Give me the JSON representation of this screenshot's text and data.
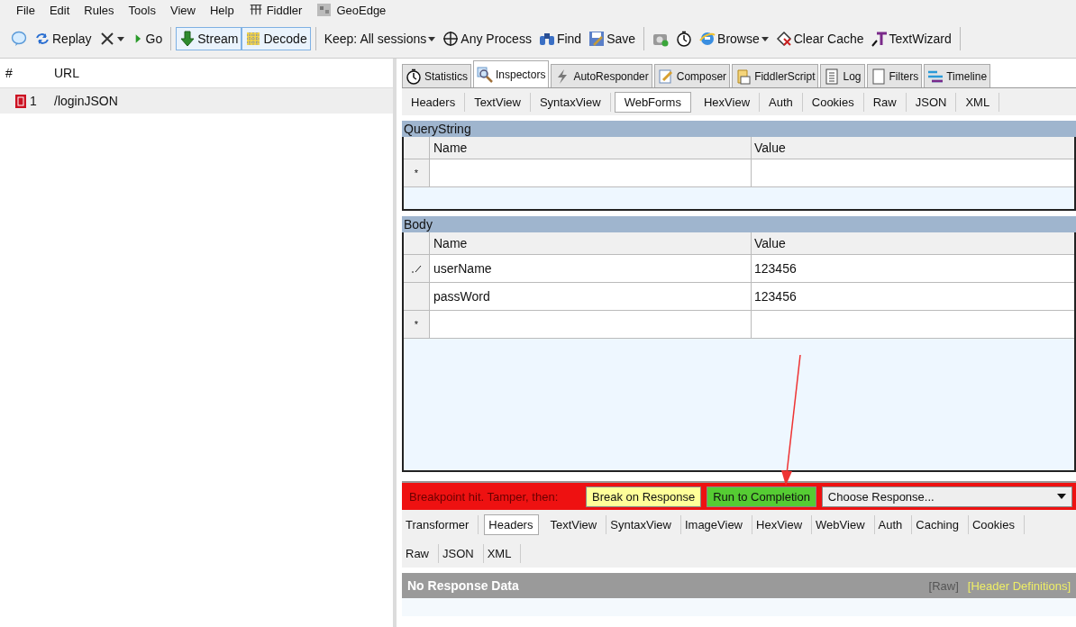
{
  "menu": [
    {
      "label": "File",
      "kind": "text"
    },
    {
      "label": "Edit",
      "kind": "text"
    },
    {
      "label": "Rules",
      "kind": "text"
    },
    {
      "label": "Tools",
      "kind": "text"
    },
    {
      "label": "View",
      "kind": "text"
    },
    {
      "label": "Help",
      "kind": "text"
    },
    {
      "label": "Fiddler",
      "kind": "grid"
    },
    {
      "label": "GeoEdge",
      "kind": "tile"
    }
  ],
  "toolbar": [
    {
      "kind": "bubble",
      "dropdown": false,
      "selected": false
    },
    {
      "label": "Replay",
      "kind": "replay",
      "dropdown": false,
      "selected": false
    },
    {
      "kind": "x",
      "dropdown": true,
      "selected": false
    },
    {
      "label": "Go",
      "kind": "play",
      "dropdown": false,
      "selected": false
    },
    {
      "kind": "separator"
    },
    {
      "label": "Stream",
      "kind": "down",
      "dropdown": false,
      "selected": true
    },
    {
      "label": "Decode",
      "kind": "decode",
      "dropdown": false,
      "selected": true
    },
    {
      "kind": "separator"
    },
    {
      "label": "Keep: All sessions",
      "kind": "text",
      "dropdown": true,
      "selected": false
    },
    {
      "label": "Any Process",
      "kind": "target",
      "dropdown": false,
      "selected": false
    },
    {
      "label": "Find",
      "kind": "binoculars",
      "dropdown": false,
      "selected": false
    },
    {
      "label": "Save",
      "kind": "save",
      "dropdown": false,
      "selected": false
    },
    {
      "kind": "separator"
    },
    {
      "kind": "camera",
      "dropdown": false,
      "selected": false
    },
    {
      "kind": "timer",
      "dropdown": false,
      "selected": false
    },
    {
      "label": "Browse",
      "kind": "globe",
      "dropdown": true,
      "selected": false
    },
    {
      "label": "Clear Cache",
      "kind": "eraser",
      "dropdown": false,
      "selected": false
    },
    {
      "label": "TextWizard",
      "kind": "wizard",
      "dropdown": false,
      "selected": false
    },
    {
      "kind": "separator"
    }
  ],
  "sessions": {
    "columns": [
      "#",
      "URL"
    ],
    "rows": [
      {
        "number": "1",
        "url": "/loginJSON",
        "selected": true
      }
    ]
  },
  "inspector_tabs": [
    {
      "label": "Statistics",
      "kind": "timer",
      "selected": false
    },
    {
      "label": "Inspectors",
      "kind": "inspect",
      "selected": true
    },
    {
      "label": "AutoResponder",
      "kind": "bolt",
      "selected": false
    },
    {
      "label": "Composer",
      "kind": "pencil",
      "selected": false
    },
    {
      "label": "FiddlerScript",
      "kind": "script",
      "selected": false
    },
    {
      "label": "Log",
      "kind": "doc",
      "selected": false
    },
    {
      "label": "Filters",
      "kind": "box",
      "selected": false
    },
    {
      "label": "Timeline",
      "kind": "lines",
      "selected": false
    }
  ],
  "request_tabs": [
    {
      "label": "Headers",
      "selected": false
    },
    {
      "label": "TextView",
      "selected": false
    },
    {
      "label": "SyntaxView",
      "selected": false
    },
    {
      "label": "WebForms",
      "selected": true
    },
    {
      "label": "HexView",
      "selected": false
    },
    {
      "label": "Auth",
      "selected": false
    },
    {
      "label": "Cookies",
      "selected": false
    },
    {
      "label": "Raw",
      "selected": false
    },
    {
      "label": "JSON",
      "selected": false
    },
    {
      "label": "XML",
      "selected": false
    }
  ],
  "query_string": {
    "title": "QueryString",
    "columns": [
      "Name",
      "Value"
    ],
    "rows": [
      {
        "marker": "*",
        "editing": false
      }
    ]
  },
  "body": {
    "title": "Body",
    "columns": [
      "Name",
      "Value"
    ],
    "rows": [
      {
        "editing": true,
        "name": "userName",
        "value": " 123456"
      },
      {
        "editing": false,
        "name": "passWord",
        "value": "123456"
      },
      {
        "marker": "*",
        "editing": false
      }
    ]
  },
  "breakpoint_bar": {
    "message": "Breakpoint hit. Tamper, then:",
    "buttons": [
      {
        "label": "Break on Response",
        "color": "#ffff99"
      },
      {
        "label": "Run to Completion",
        "color": "#55cc33"
      }
    ],
    "response_select": "Choose Response..."
  },
  "response_tab_rows": [
    [
      {
        "label": "Transformer",
        "selected": false
      },
      {
        "label": "Headers",
        "selected": true
      },
      {
        "label": "TextView",
        "selected": false
      },
      {
        "label": "SyntaxView",
        "selected": false
      },
      {
        "label": "ImageView",
        "selected": false
      },
      {
        "label": "HexView",
        "selected": false
      },
      {
        "label": "WebView",
        "selected": false
      },
      {
        "label": "Auth",
        "selected": false
      },
      {
        "label": "Caching",
        "selected": false
      },
      {
        "label": "Cookies",
        "selected": false
      }
    ],
    [
      {
        "label": "Raw",
        "selected": false
      },
      {
        "label": "JSON",
        "selected": false
      },
      {
        "label": "XML",
        "selected": false
      }
    ]
  ],
  "response_header": {
    "title": "No Response Data",
    "links": [
      {
        "label": "[Raw]",
        "color": "#555555"
      },
      {
        "label": "[Header Definitions]",
        "color": "#eeee66"
      }
    ]
  }
}
